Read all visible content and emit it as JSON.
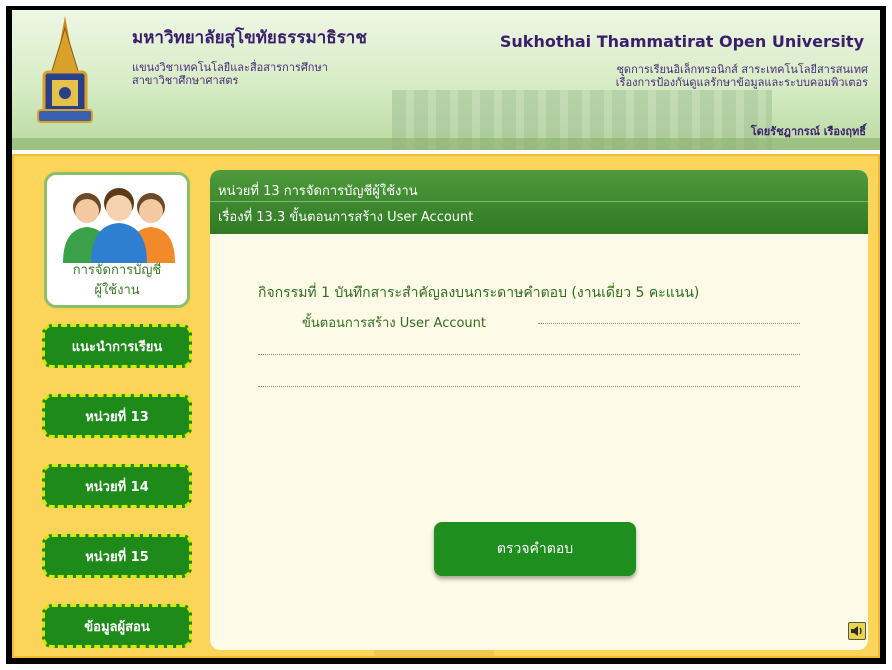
{
  "header": {
    "title_th": "มหาวิทยาลัยสุโขทัยธรรมาธิราช",
    "subtitle_th_1": "แขนงวิชาเทคโนโลยีและสื่อสารการศึกษา",
    "subtitle_th_2": "สาขาวิชาศึกษาศาสตร",
    "title_en": "Sukhothai Thammatirat Open University",
    "course_line_1": "ชุดการเรียนอิเล็กทรอนิกส์ สาระเทคโนโลยีสารสนเทศ",
    "course_line_2": "เรื่องการป้องกันดูแลรักษาข้อมูลและระบบคอมพิวเตอร",
    "author": "โดยรัชฎากรณ์ เรืองฤทธิ์"
  },
  "sidebar": {
    "profile_label_1": "การจัดการบัญชี",
    "profile_label_2": "ผู้ใช้งาน",
    "items": [
      {
        "label": "แนะนำการเรียน"
      },
      {
        "label": "หน่วยที่ 13"
      },
      {
        "label": "หน่วยที่ 14"
      },
      {
        "label": "หน่วยที่ 15"
      },
      {
        "label": "ข้อมูลผู้สอน"
      }
    ]
  },
  "content": {
    "unit_title": "หน่วยที่ 13 การจัดการบัญชีผู้ใช้งาน",
    "topic_title": "เรื่องที่ 13.3 ขั้นตอนการสร้าง User Account",
    "activity_text": "กิจกรรมที่ 1 บันทึกสาระสำคัญลงบนกระดาษคำตอบ (งานเดี่ยว 5 คะแนน)",
    "steps_text": "ขั้นตอนการสร้าง User Account",
    "check_button": "ตรวจคำตอบ"
  },
  "icons": {
    "emblem": "university-emblem-icon",
    "profile": "users-group-icon",
    "sound": "speaker-icon"
  },
  "colors": {
    "accent_green": "#1e8a1a",
    "background_yellow": "#fdd45a",
    "nav_border": "#d9e800"
  }
}
